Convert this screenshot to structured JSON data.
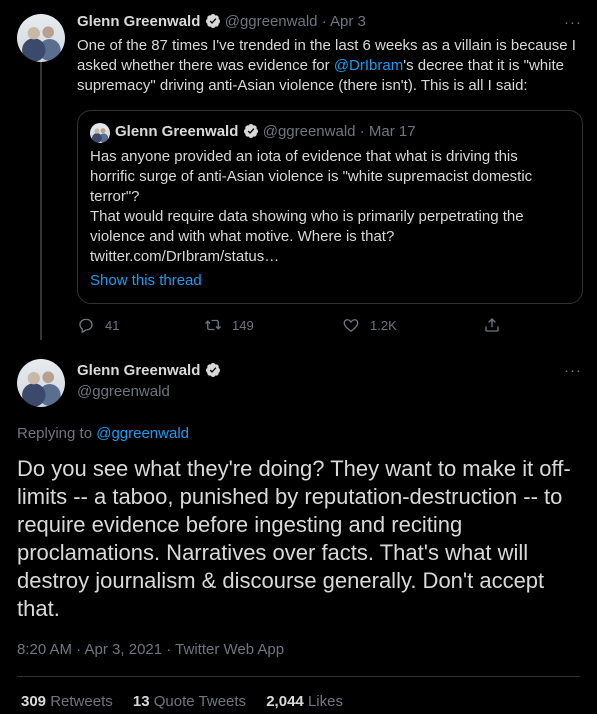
{
  "tweet1": {
    "author_name": "Glenn Greenwald",
    "handle": "@ggreenwald",
    "date": "· Apr 3",
    "more": "···",
    "text_before": "One of the 87 times I've trended in the last 6 weeks as a villain is because I asked whether there was evidence for ",
    "mention": "@DrIbram",
    "text_after": "'s decree that it is \"white supremacy\" driving anti-Asian violence (there isn't). This is all I said:",
    "quote": {
      "author_name": "Glenn Greenwald",
      "handle": "@ggreenwald",
      "date": "· Mar 17",
      "text_p1": "Has anyone provided an iota of evidence that what is driving this horrific surge of anti-Asian violence is \"white supremacist domestic terror\"?",
      "text_p2": "That would require data showing who is primarily perpetrating the violence and with what motive. Where is that? twitter.com/DrIbram/status…",
      "show_thread": "Show this thread"
    },
    "actions": {
      "replies": "41",
      "retweets": "149",
      "likes": "1.2K"
    }
  },
  "tweet2": {
    "author_name": "Glenn Greenwald",
    "handle": "@ggreenwald",
    "more": "···",
    "replying_prefix": "Replying to ",
    "replying_to": "@ggreenwald",
    "text": "Do you see what they're doing? They want to make it off-limits -- a taboo, punished by reputation-destruction -- to require evidence before ingesting and reciting proclamations. Narratives over facts. That's what will destroy journalism & discourse generally. Don't accept that.",
    "meta": "8:20 AM · Apr 3, 2021 · Twitter Web App",
    "stats": {
      "retweets_count": "309",
      "retweets_label": "Retweets",
      "quotes_count": "13",
      "quotes_label": "Quote Tweets",
      "likes_count": "2,044",
      "likes_label": "Likes"
    }
  },
  "colors": {
    "background": "#000000",
    "text": "#d9d9d9",
    "muted": "#6e767d",
    "link": "#1d9bf0",
    "border": "#2f3336"
  }
}
